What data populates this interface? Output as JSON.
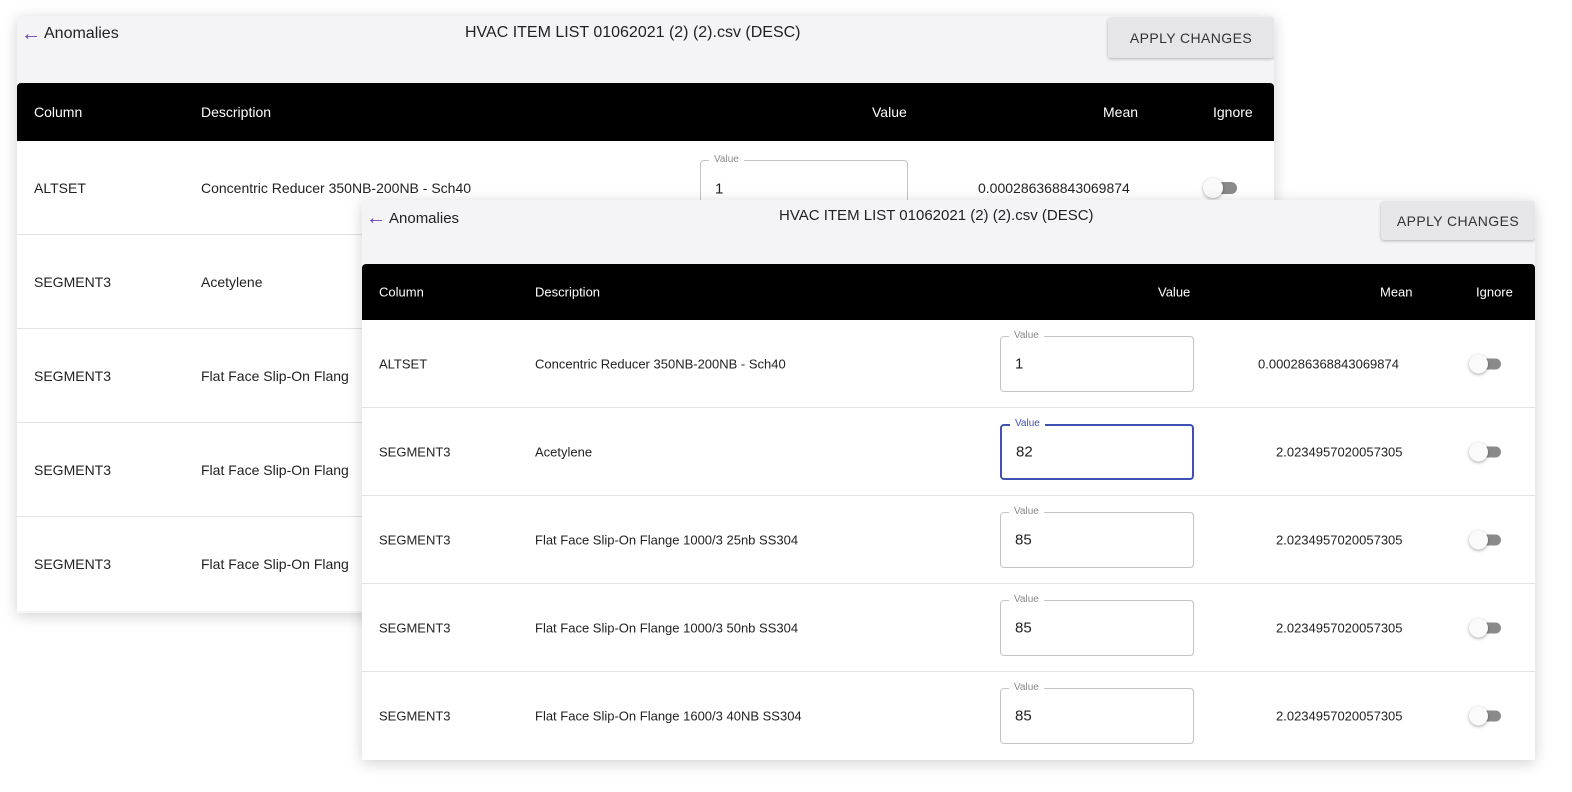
{
  "back_panel": {
    "back_label": "Anomalies",
    "file_title": "HVAC ITEM LIST 01062021 (2) (2).csv (DESC)",
    "apply_label": "APPLY CHANGES",
    "headers": {
      "column": "Column",
      "description": "Description",
      "value": "Value",
      "mean": "Mean",
      "ignore": "Ignore"
    },
    "rows": [
      {
        "column": "ALTSET",
        "description": "Concentric Reducer 350NB-200NB - Sch40",
        "value_label": "Value",
        "value": "1",
        "mean": "0.000286368843069874"
      },
      {
        "column": "SEGMENT3",
        "description": "Acetylene"
      },
      {
        "column": "SEGMENT3",
        "description": "Flat Face Slip-On Flang"
      },
      {
        "column": "SEGMENT3",
        "description": "Flat Face Slip-On Flang"
      },
      {
        "column": "SEGMENT3",
        "description": "Flat Face Slip-On Flang"
      }
    ]
  },
  "front_panel": {
    "back_label": "Anomalies",
    "file_title": "HVAC ITEM LIST 01062021 (2) (2).csv (DESC)",
    "apply_label": "APPLY CHANGES",
    "headers": {
      "column": "Column",
      "description": "Description",
      "value": "Value",
      "mean": "Mean",
      "ignore": "Ignore"
    },
    "rows": [
      {
        "column": "ALTSET",
        "description": "Concentric Reducer 350NB-200NB - Sch40",
        "value_label": "Value",
        "value": "1",
        "mean": "0.000286368843069874",
        "ignore": false,
        "focused": false
      },
      {
        "column": "SEGMENT3",
        "description": "Acetylene",
        "value_label": "Value",
        "value": "82",
        "mean": "2.0234957020057305",
        "ignore": false,
        "focused": true
      },
      {
        "column": "SEGMENT3",
        "description": "Flat Face Slip-On Flange 1000/3 25nb SS304",
        "value_label": "Value",
        "value": "85",
        "mean": "2.0234957020057305",
        "ignore": false,
        "focused": false
      },
      {
        "column": "SEGMENT3",
        "description": "Flat Face Slip-On Flange 1000/3 50nb SS304",
        "value_label": "Value",
        "value": "85",
        "mean": "2.0234957020057305",
        "ignore": false,
        "focused": false
      },
      {
        "column": "SEGMENT3",
        "description": "Flat Face Slip-On Flange 1600/3 40NB SS304",
        "value_label": "Value",
        "value": "85",
        "mean": "2.0234957020057305",
        "ignore": false,
        "focused": false
      }
    ]
  },
  "colors": {
    "accent": "#3f51b5",
    "back_arrow": "#6b3fb5",
    "header_bg": "#000000",
    "toggle_track": "#8a8a8a"
  },
  "icons": {
    "back": "arrow-left-icon"
  }
}
